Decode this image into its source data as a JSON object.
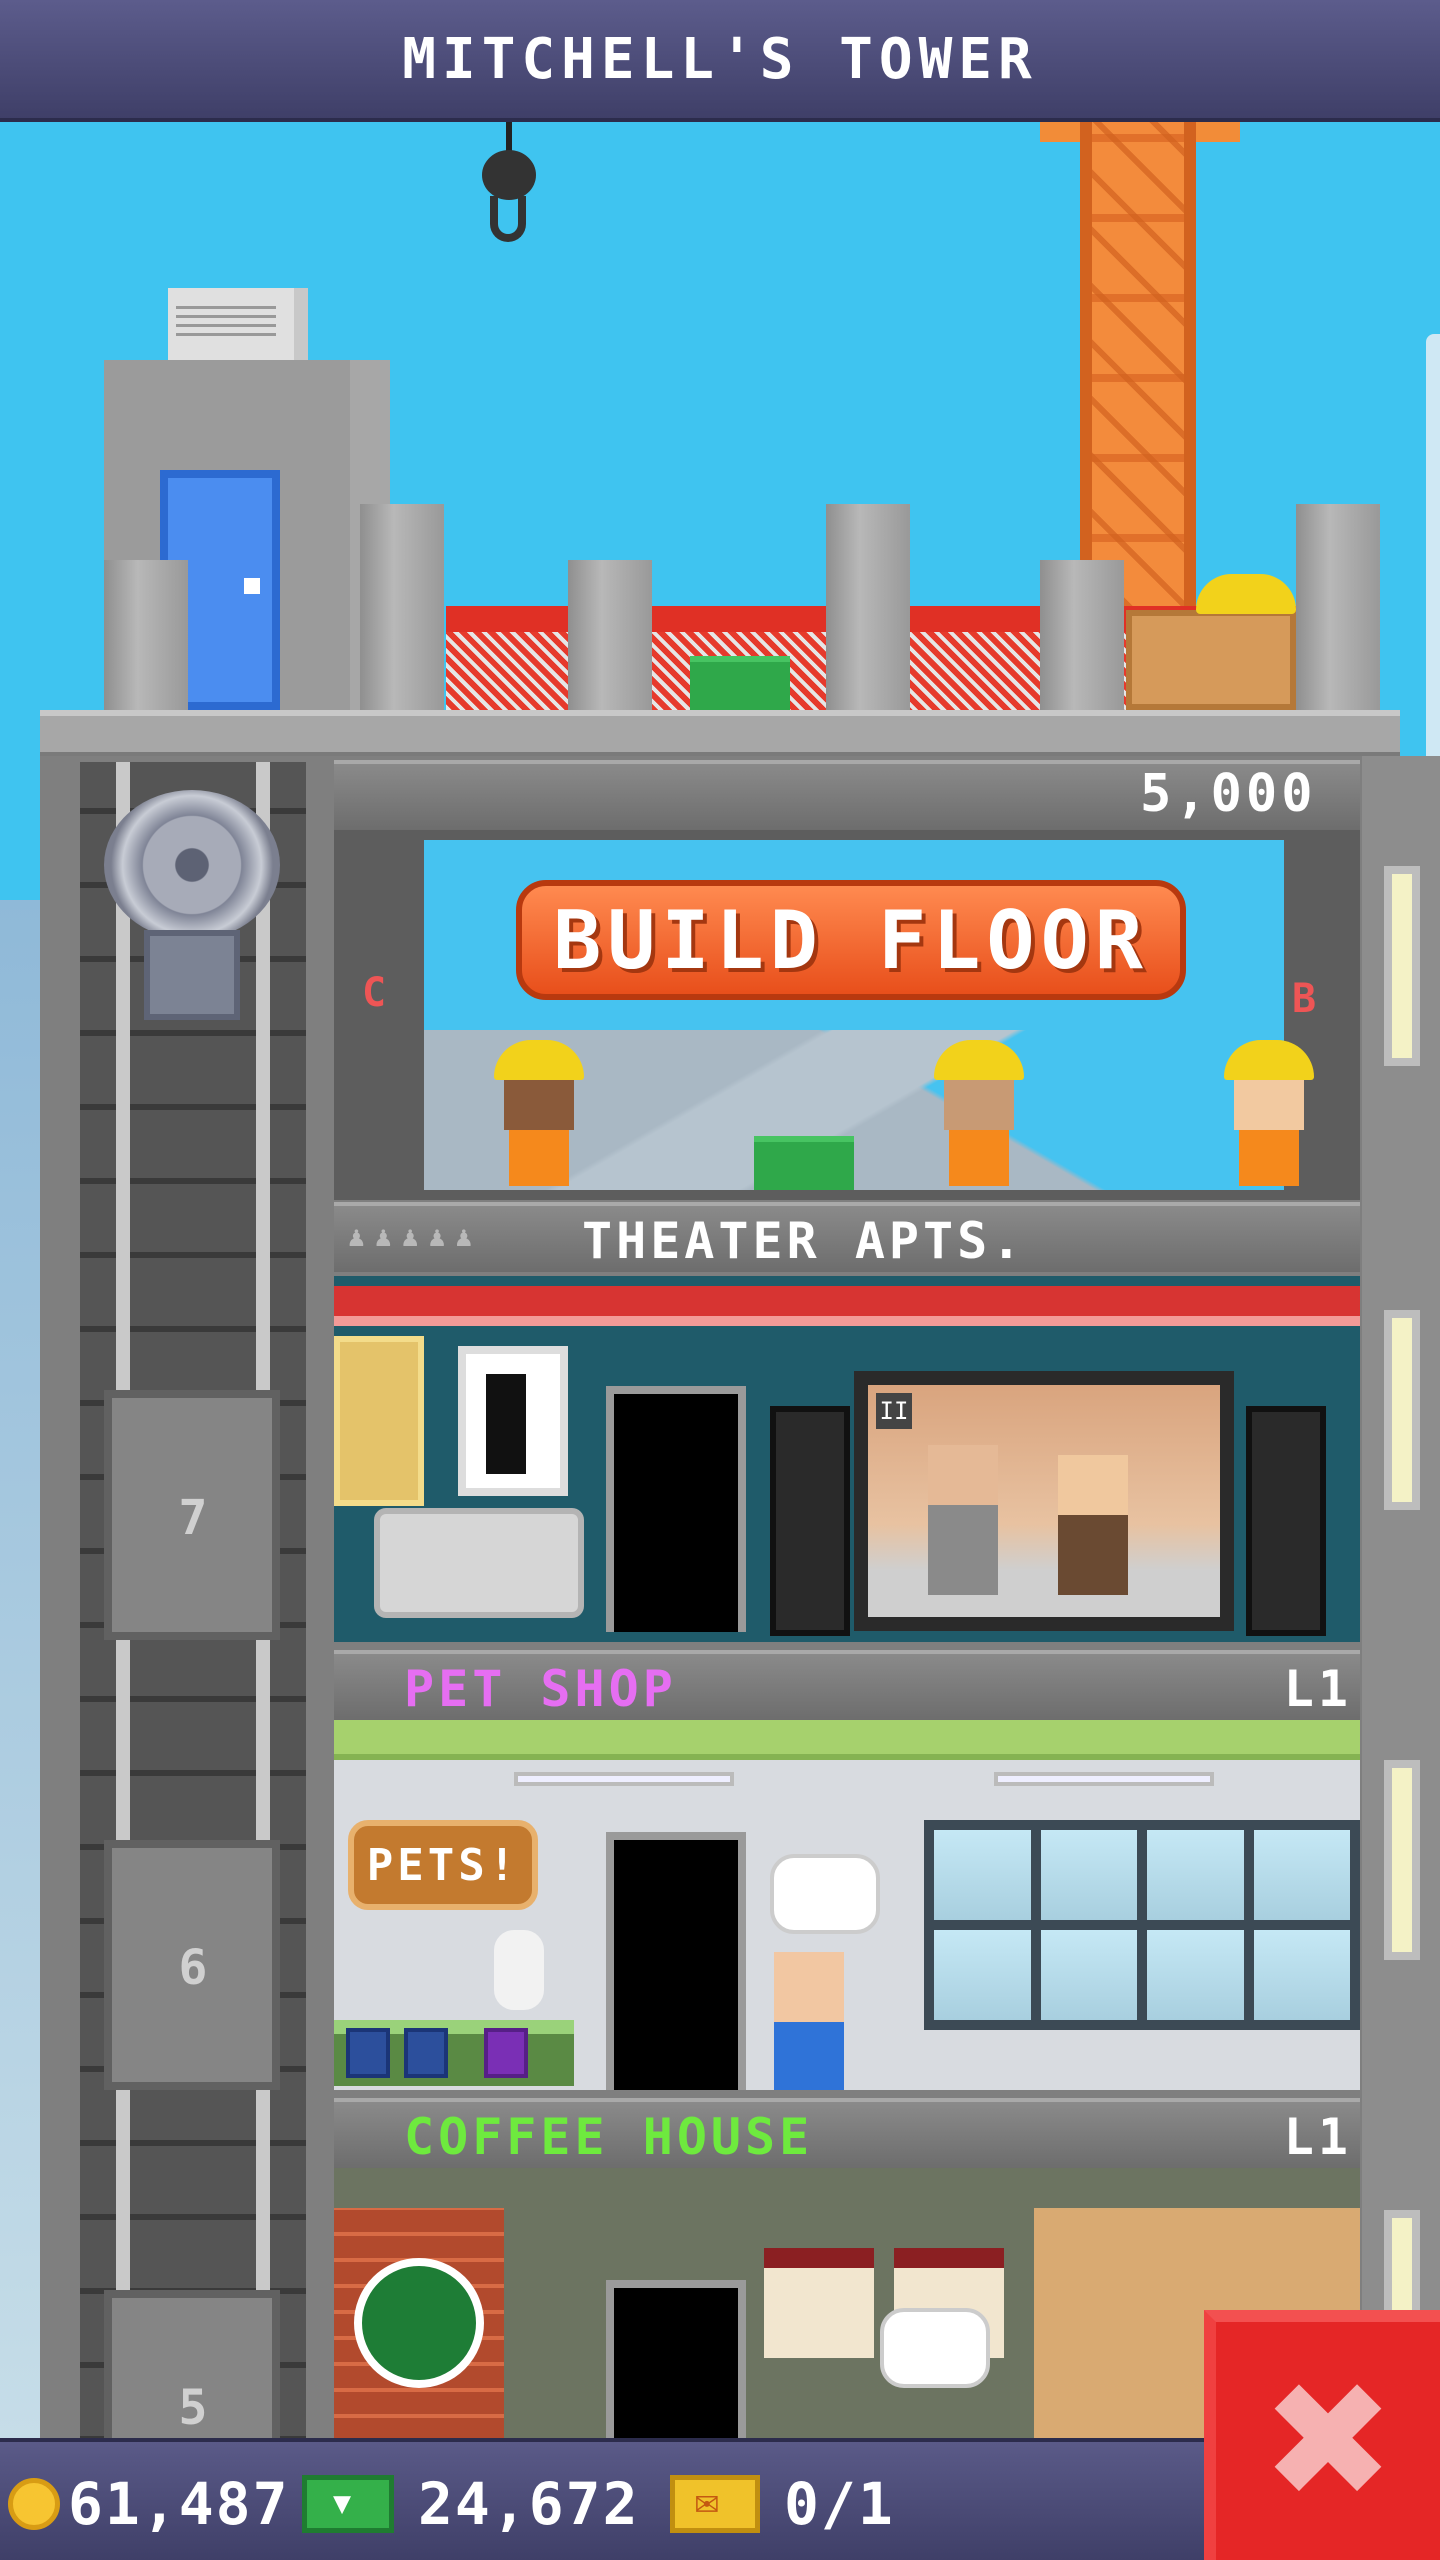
{
  "header": {
    "title": "MITCHELL'S TOWER"
  },
  "construction": {
    "cost": "5,000",
    "build_button_label": "BUILD FLOOR",
    "left_marker": "C",
    "right_marker": "B"
  },
  "floors": [
    {
      "name": "THEATER APTS.",
      "level": "",
      "name_color": "#ffffff"
    },
    {
      "name": "PET SHOP",
      "level": "L1",
      "name_color": "#e66ef2"
    },
    {
      "name": "COFFEE HOUSE",
      "level": "L1",
      "name_color": "#6eea3e"
    }
  ],
  "pet_shop": {
    "sign": "PETS!"
  },
  "theater": {
    "pause_symbol": "II"
  },
  "elevator": {
    "floor_numbers": [
      "7",
      "6",
      "5"
    ]
  },
  "status_bar": {
    "coins": "61,487",
    "bux": "24,672",
    "tickets": "0/1",
    "coin_icon": "coin-icon",
    "bux_icon": "tower-bux-icon",
    "ticket_icon": "ticket-icon"
  },
  "close_button": {
    "symbol": "✖",
    "color": "#e52626"
  },
  "colors": {
    "sky": "#3fc4f0",
    "title_bar": "#4b4b78",
    "build_button": "#f06a2e"
  }
}
